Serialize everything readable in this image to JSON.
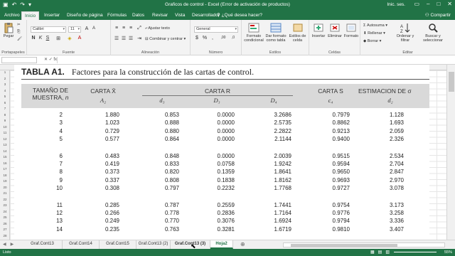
{
  "window": {
    "title": "Graficos de control - Excel (Error de activación de productos)",
    "account": "Inic. ses."
  },
  "ribbon_tabs": [
    "Archivo",
    "Inicio",
    "Insertar",
    "Diseño de página",
    "Fórmulas",
    "Datos",
    "Revisar",
    "Vista",
    "Desarrollador"
  ],
  "active_tab": "Inicio",
  "tell_me": "¿Qué desea hacer?",
  "share": "Compartir",
  "ribbon": {
    "clipboard": {
      "paste": "Pegar",
      "label": "Portapapeles"
    },
    "font": {
      "name": "Calibri",
      "size": "11",
      "label": "Fuente"
    },
    "alignment": {
      "wrap": "Ajustar texto",
      "merge": "Combinar y centrar",
      "label": "Alineación"
    },
    "number": {
      "format": "General",
      "label": "Número"
    },
    "styles": {
      "conditional": "Formato condicional",
      "table": "Dar formato como tabla",
      "cell": "Estilos de celda",
      "label": "Estilos"
    },
    "cells": {
      "insert": "Insertar",
      "delete": "Eliminar",
      "format": "Formato",
      "label": "Celdas"
    },
    "editing": {
      "autosum": "Autosuma",
      "fill": "Rellenar",
      "clear": "Borrar",
      "sort": "Ordenar y filtrar",
      "find": "Buscar y seleccionar",
      "label": "Editar"
    }
  },
  "table_image": {
    "title_bold": "TABLA A1.",
    "title": "Factores para la construcción de las cartas de control.",
    "headers": {
      "n_line1": "TAMAÑO DE",
      "n_line2": "MUESTRA,",
      "n_sym": "n",
      "xbar": "CARTA X̄",
      "a2": "A₂",
      "cartar": "CARTA R",
      "d3": "d₃",
      "D3": "D₃",
      "D4": "D₄",
      "cartas": "CARTA S",
      "c4": "c₄",
      "est": "ESTIMACION DE σ",
      "d2": "d₂"
    },
    "rows": [
      [
        "2",
        "1.880",
        "0.853",
        "0.0000",
        "3.2686",
        "0.7979",
        "1.128"
      ],
      [
        "3",
        "1.023",
        "0.888",
        "0.0000",
        "2.5735",
        "0.8862",
        "1.693"
      ],
      [
        "4",
        "0.729",
        "0.880",
        "0.0000",
        "2.2822",
        "0.9213",
        "2.059"
      ],
      [
        "5",
        "0.577",
        "0.864",
        "0.0000",
        "2.1144",
        "0.9400",
        "2.326"
      ],
      [
        "6",
        "0.483",
        "0.848",
        "0.0000",
        "2.0039",
        "0.9515",
        "2.534"
      ],
      [
        "7",
        "0.419",
        "0.833",
        "0.0758",
        "1.9242",
        "0.9594",
        "2.704"
      ],
      [
        "8",
        "0.373",
        "0.820",
        "0.1359",
        "1.8641",
        "0.9650",
        "2.847"
      ],
      [
        "9",
        "0.337",
        "0.808",
        "0.1838",
        "1.8162",
        "0.9693",
        "2.970"
      ],
      [
        "10",
        "0.308",
        "0.797",
        "0.2232",
        "1.7768",
        "0.9727",
        "3.078"
      ],
      [
        "11",
        "0.285",
        "0.787",
        "0.2559",
        "1.7441",
        "0.9754",
        "3.173"
      ],
      [
        "12",
        "0.266",
        "0.778",
        "0.2836",
        "1.7164",
        "0.9776",
        "3.258"
      ],
      [
        "13",
        "0.249",
        "0.770",
        "0.3076",
        "1.6924",
        "0.9794",
        "3.336"
      ],
      [
        "14",
        "0.235",
        "0.763",
        "0.3281",
        "1.6719",
        "0.9810",
        "3.407"
      ]
    ]
  },
  "sheet_tabs": [
    "Graf.Cont13",
    "Graf.Cont14",
    "Graf.Cont15",
    "Graf.Cont13 (2)",
    "Graf.Cont13 (3)",
    "Hoja2"
  ],
  "active_sheet": "Hoja2",
  "status": {
    "ready": "Listo",
    "zoom": "55%"
  },
  "colors": {
    "excel_green": "#217346"
  }
}
